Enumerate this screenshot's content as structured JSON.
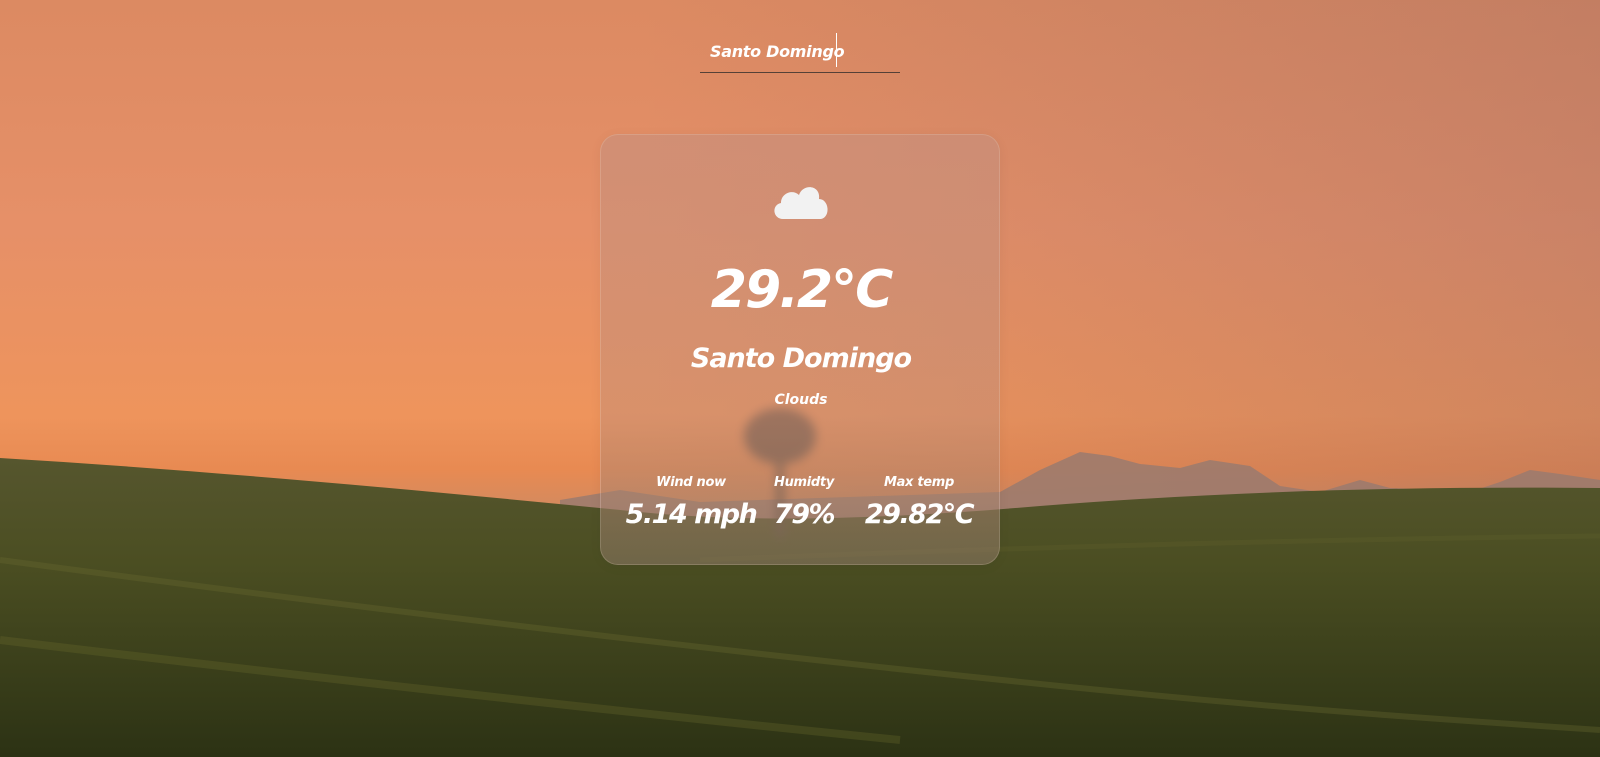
{
  "search": {
    "value": "Santo Domingo"
  },
  "weather": {
    "icon": "cloud-icon",
    "temperature": "29.2°C",
    "city": "Santo Domingo",
    "condition": "Clouds"
  },
  "stats": {
    "wind": {
      "label": "Wind now",
      "value": "5.14 mph"
    },
    "humidity": {
      "label": "Humidty",
      "value": "79%"
    },
    "max_temp": {
      "label": "Max temp",
      "value": "29.82°C"
    }
  }
}
